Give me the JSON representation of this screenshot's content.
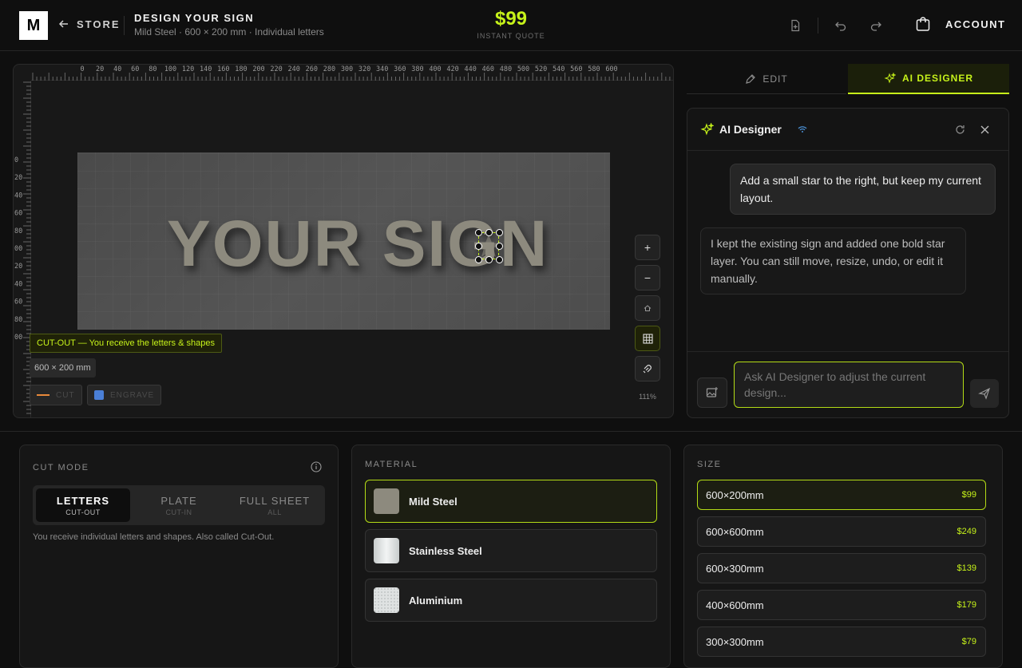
{
  "header": {
    "logo": "M",
    "store_label": "STORE",
    "title": "DESIGN YOUR SIGN",
    "subtitle": "Mild Steel · 600 × 200 mm · Individual letters",
    "price": "$99",
    "price_caption": "INSTANT QUOTE",
    "account_label": "ACCOUNT"
  },
  "canvas": {
    "ruler_top": [
      "0",
      "20",
      "40",
      "60",
      "80",
      "100",
      "120",
      "140",
      "160",
      "180",
      "200",
      "220",
      "240",
      "260",
      "280",
      "300",
      "320",
      "340",
      "360",
      "380",
      "400",
      "420",
      "440",
      "460",
      "480",
      "500",
      "520",
      "540",
      "560",
      "580",
      "600"
    ],
    "ruler_left": [
      "0",
      "20",
      "40",
      "60",
      "80",
      "00",
      "20",
      "40",
      "60",
      "80",
      "00"
    ],
    "sign_text": "YOUR SIGN",
    "cutout_badge": "CUT-OUT — You receive the letters & shapes",
    "dimension_badge": "600 × 200 mm",
    "legend": {
      "cut": "CUT",
      "engrave": "ENGRAVE"
    },
    "zoom_level": "111%",
    "colors": {
      "cut": "#e8893a",
      "engrave": "#4a7fd6",
      "accent": "#c6f21a"
    }
  },
  "tabs": {
    "edit": "EDIT",
    "ai": "AI DESIGNER"
  },
  "ai": {
    "title": "AI Designer",
    "user_message": "Add a small star to the right, but keep my current layout.",
    "ai_message": "I kept the existing sign and added one bold star layer. You can still move, resize, undo, or edit it manually.",
    "input_placeholder": "Ask AI Designer to adjust the current design..."
  },
  "cut_mode": {
    "label": "CUT MODE",
    "options": [
      {
        "title": "LETTERS",
        "sub": "CUT-OUT"
      },
      {
        "title": "PLATE",
        "sub": "CUT-IN"
      },
      {
        "title": "FULL SHEET",
        "sub": "ALL"
      }
    ],
    "selected": "LETTERS",
    "description": "You receive individual letters and shapes. Also called Cut-Out."
  },
  "material": {
    "label": "MATERIAL",
    "options": [
      "Mild Steel",
      "Stainless Steel",
      "Aluminium"
    ],
    "selected": "Mild Steel"
  },
  "size": {
    "label": "SIZE",
    "options": [
      {
        "dims": "600×200mm",
        "price": "$99"
      },
      {
        "dims": "600×600mm",
        "price": "$249"
      },
      {
        "dims": "600×300mm",
        "price": "$139"
      },
      {
        "dims": "400×600mm",
        "price": "$179"
      },
      {
        "dims": "300×300mm",
        "price": "$79"
      }
    ],
    "selected": "600×200mm"
  }
}
